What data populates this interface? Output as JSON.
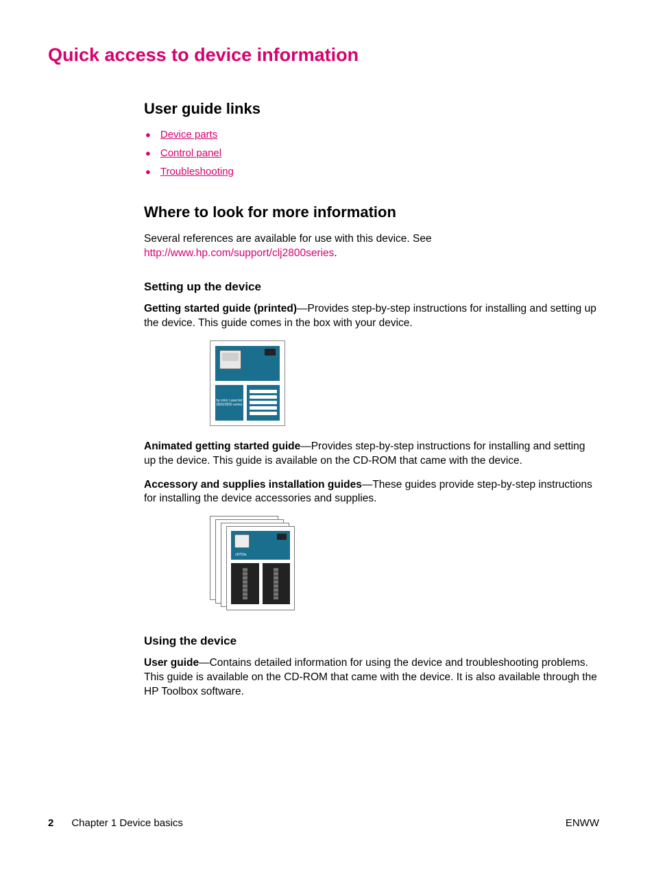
{
  "title": "Quick access to device information",
  "userGuide": {
    "heading": "User guide links",
    "items": [
      {
        "label": "Device parts"
      },
      {
        "label": "Control panel"
      },
      {
        "label": "Troubleshooting"
      }
    ]
  },
  "moreInfo": {
    "heading": "Where to look for more information",
    "introPrefix": "Several references are available for use with this device. See ",
    "introLink": "http://www.hp.com/support/clj2800series",
    "introSuffix": "."
  },
  "setup": {
    "heading": "Setting up the device",
    "p1Bold": "Getting started guide (printed)",
    "p1Rest": "—Provides step-by-step instructions for installing and setting up the device. This guide comes in the box with your device.",
    "p2Bold": "Animated getting started guide",
    "p2Rest": "—Provides step-by-step instructions for installing and setting up the device. This guide is available on the CD-ROM that came with the device.",
    "p3Bold": "Accessory and supplies installation guides",
    "p3Rest": "—These guides provide step-by-step instructions for installing the device accessories and supplies."
  },
  "using": {
    "heading": "Using the device",
    "p1Bold": "User guide",
    "p1Rest": "—Contains detailed information for using the device and troubleshooting problems. This guide is available on the CD-ROM that came with the device. It is also available through the HP Toolbox software."
  },
  "footer": {
    "pageNumber": "2",
    "chapter": "Chapter 1  Device basics",
    "right": "ENWW"
  }
}
